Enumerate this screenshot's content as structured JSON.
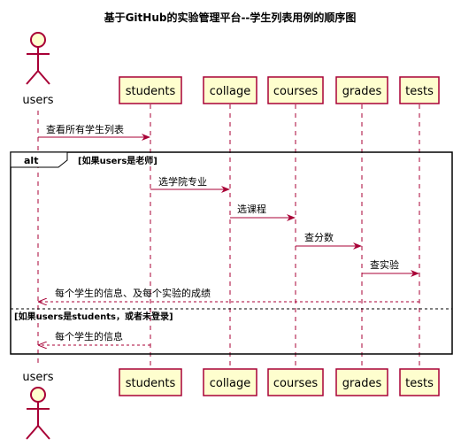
{
  "title": "基于GitHub的实验管理平台--学生列表用例的顺序图",
  "actor": {
    "name": "users"
  },
  "participants": [
    {
      "id": "students",
      "label": "students"
    },
    {
      "id": "collage",
      "label": "collage"
    },
    {
      "id": "courses",
      "label": "courses"
    },
    {
      "id": "grades",
      "label": "grades"
    },
    {
      "id": "tests",
      "label": "tests"
    }
  ],
  "messages": [
    {
      "id": "m1",
      "from": "users",
      "to": "students",
      "label": "查看所有学生列表",
      "style": "solid"
    },
    {
      "id": "m2",
      "from": "students",
      "to": "collage",
      "label": "选学院专业",
      "style": "solid"
    },
    {
      "id": "m3",
      "from": "collage",
      "to": "courses",
      "label": "选课程",
      "style": "solid"
    },
    {
      "id": "m4",
      "from": "courses",
      "to": "grades",
      "label": "查分数",
      "style": "solid"
    },
    {
      "id": "m5",
      "from": "grades",
      "to": "tests",
      "label": "查实验",
      "style": "solid"
    },
    {
      "id": "m6",
      "from": "tests",
      "to": "users",
      "label": "每个学生的信息、及每个实验的成绩",
      "style": "dashed"
    },
    {
      "id": "m7",
      "from": "students",
      "to": "users",
      "label": "每个学生的信息",
      "style": "dashed"
    }
  ],
  "fragment": {
    "operator": "alt",
    "guard1": "[如果users是老师]",
    "guard2": "[如果users是students，或者未登录]"
  },
  "colors": {
    "participant_fill": "#FEFECE",
    "participant_border": "#A80036",
    "lifeline": "#A80036",
    "arrow": "#A80036",
    "fragment_border": "#000000"
  }
}
